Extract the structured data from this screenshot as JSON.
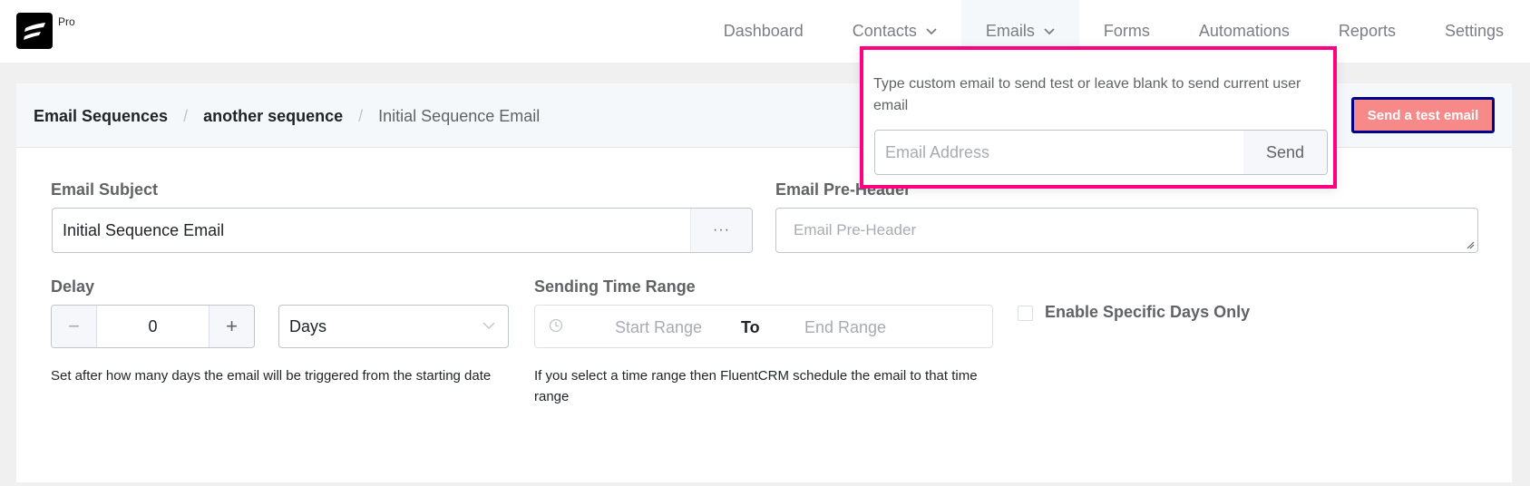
{
  "app": {
    "logo_badge": "Pro"
  },
  "nav": {
    "items": [
      {
        "label": "Dashboard",
        "dropdown": false,
        "active": false
      },
      {
        "label": "Contacts",
        "dropdown": true,
        "active": false
      },
      {
        "label": "Emails",
        "dropdown": true,
        "active": true
      },
      {
        "label": "Forms",
        "dropdown": false,
        "active": false
      },
      {
        "label": "Automations",
        "dropdown": false,
        "active": false
      },
      {
        "label": "Reports",
        "dropdown": false,
        "active": false
      },
      {
        "label": "Settings",
        "dropdown": false,
        "active": false
      }
    ]
  },
  "breadcrumb": {
    "items": [
      "Email Sequences",
      "another sequence",
      "Initial Sequence Email"
    ],
    "separator": "/"
  },
  "toolbar": {
    "send_test_label": "Send a test email"
  },
  "popover": {
    "description": "Type custom email to send test or leave blank to send current user email",
    "email_placeholder": "Email Address",
    "email_value": "",
    "send_label": "Send"
  },
  "form": {
    "subject": {
      "label": "Email Subject",
      "value": "Initial Sequence Email",
      "more_label": "···"
    },
    "preheader": {
      "label": "Email Pre-Header",
      "placeholder": "Email Pre-Header",
      "value": ""
    },
    "delay": {
      "label": "Delay",
      "value": "0",
      "minus": "−",
      "plus": "+",
      "unit": "Days",
      "help": "Set after how many days the email will be triggered from the starting date"
    },
    "time_range": {
      "label": "Sending Time Range",
      "start_placeholder": "Start Range",
      "separator": "To",
      "end_placeholder": "End Range",
      "help": "If you select a time range then FluentCRM schedule the email to that time range"
    },
    "specific_days": {
      "label": "Enable Specific Days Only",
      "checked": false
    }
  },
  "colors": {
    "send_test_bg": "#f78989",
    "send_test_border": "#00008b",
    "popover_highlight": "#ff0080"
  }
}
